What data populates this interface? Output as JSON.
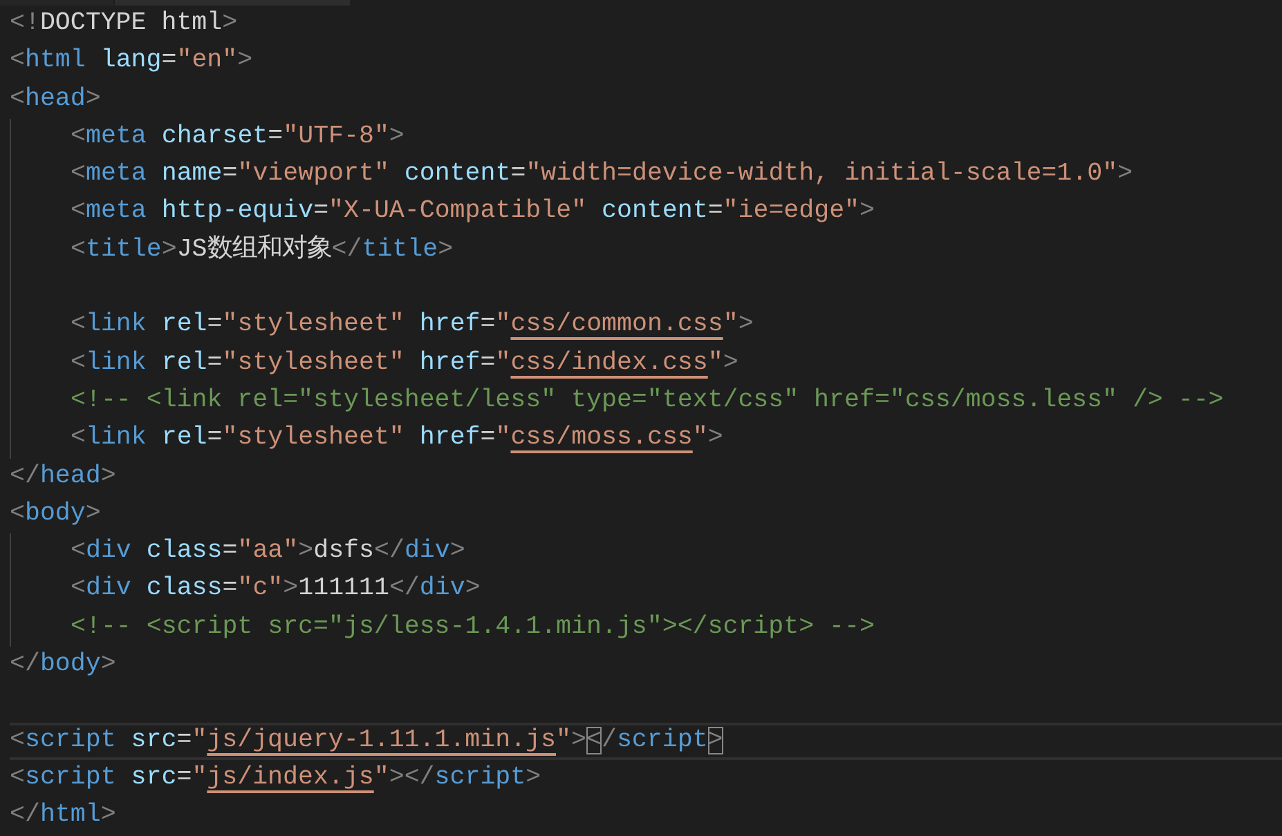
{
  "lines": [
    {
      "kind": "code",
      "current": false,
      "tokens": [
        {
          "kind": "punct",
          "text": "<!"
        },
        {
          "kind": "text",
          "text": "DOCTYPE html"
        },
        {
          "kind": "punct",
          "text": ">"
        }
      ]
    },
    {
      "kind": "code",
      "current": false,
      "tokens": [
        {
          "kind": "punct",
          "text": "<"
        },
        {
          "kind": "tag",
          "text": "html"
        },
        {
          "kind": "attr",
          "text": " lang"
        },
        {
          "kind": "text",
          "text": "="
        },
        {
          "kind": "string",
          "text": "\"en\""
        },
        {
          "kind": "punct",
          "text": ">"
        }
      ]
    },
    {
      "kind": "code",
      "current": false,
      "tokens": [
        {
          "kind": "punct",
          "text": "<"
        },
        {
          "kind": "tag",
          "text": "head"
        },
        {
          "kind": "punct",
          "text": ">"
        }
      ],
      "children": [
        {
          "kind": "code",
          "current": false,
          "tokens": [
            {
              "kind": "punct",
              "text": "<"
            },
            {
              "kind": "tag",
              "text": "meta"
            },
            {
              "kind": "attr",
              "text": " charset"
            },
            {
              "kind": "text",
              "text": "="
            },
            {
              "kind": "string",
              "text": "\"UTF-8\""
            },
            {
              "kind": "punct",
              "text": ">"
            }
          ]
        },
        {
          "kind": "code",
          "current": false,
          "tokens": [
            {
              "kind": "punct",
              "text": "<"
            },
            {
              "kind": "tag",
              "text": "meta"
            },
            {
              "kind": "attr",
              "text": " name"
            },
            {
              "kind": "text",
              "text": "="
            },
            {
              "kind": "string",
              "text": "\"viewport\""
            },
            {
              "kind": "attr",
              "text": " content"
            },
            {
              "kind": "text",
              "text": "="
            },
            {
              "kind": "string",
              "text": "\"width=device-width, initial-scale=1.0\""
            },
            {
              "kind": "punct",
              "text": ">"
            }
          ]
        },
        {
          "kind": "code",
          "current": false,
          "tokens": [
            {
              "kind": "punct",
              "text": "<"
            },
            {
              "kind": "tag",
              "text": "meta"
            },
            {
              "kind": "attr",
              "text": " http-equiv"
            },
            {
              "kind": "text",
              "text": "="
            },
            {
              "kind": "string",
              "text": "\"X-UA-Compatible\""
            },
            {
              "kind": "attr",
              "text": " content"
            },
            {
              "kind": "text",
              "text": "="
            },
            {
              "kind": "string",
              "text": "\"ie=edge\""
            },
            {
              "kind": "punct",
              "text": ">"
            }
          ]
        },
        {
          "kind": "code",
          "current": false,
          "tokens": [
            {
              "kind": "punct",
              "text": "<"
            },
            {
              "kind": "tag",
              "text": "title"
            },
            {
              "kind": "punct",
              "text": ">"
            },
            {
              "kind": "text",
              "text": "JS数组和对象"
            },
            {
              "kind": "punct",
              "text": "</"
            },
            {
              "kind": "tag",
              "text": "title"
            },
            {
              "kind": "punct",
              "text": ">"
            }
          ]
        },
        {
          "kind": "blank",
          "current": false
        },
        {
          "kind": "code",
          "current": false,
          "tokens": [
            {
              "kind": "punct",
              "text": "<"
            },
            {
              "kind": "tag",
              "text": "link"
            },
            {
              "kind": "attr",
              "text": " rel"
            },
            {
              "kind": "text",
              "text": "="
            },
            {
              "kind": "string",
              "text": "\"stylesheet\""
            },
            {
              "kind": "attr",
              "text": " href"
            },
            {
              "kind": "text",
              "text": "="
            },
            {
              "kind": "string",
              "text": "\""
            },
            {
              "kind": "link",
              "text": "css/common.css"
            },
            {
              "kind": "string",
              "text": "\""
            },
            {
              "kind": "punct",
              "text": ">"
            }
          ]
        },
        {
          "kind": "code",
          "current": false,
          "tokens": [
            {
              "kind": "punct",
              "text": "<"
            },
            {
              "kind": "tag",
              "text": "link"
            },
            {
              "kind": "attr",
              "text": " rel"
            },
            {
              "kind": "text",
              "text": "="
            },
            {
              "kind": "string",
              "text": "\"stylesheet\""
            },
            {
              "kind": "attr",
              "text": " href"
            },
            {
              "kind": "text",
              "text": "="
            },
            {
              "kind": "string",
              "text": "\""
            },
            {
              "kind": "link",
              "text": "css/index.css"
            },
            {
              "kind": "string",
              "text": "\""
            },
            {
              "kind": "punct",
              "text": ">"
            }
          ]
        },
        {
          "kind": "code",
          "current": false,
          "tokens": [
            {
              "kind": "comment",
              "text": "<!-- <link rel=\"stylesheet/less\" type=\"text/css\" href=\"css/moss.less\" /> -->"
            }
          ]
        },
        {
          "kind": "code",
          "current": false,
          "tokens": [
            {
              "kind": "punct",
              "text": "<"
            },
            {
              "kind": "tag",
              "text": "link"
            },
            {
              "kind": "attr",
              "text": " rel"
            },
            {
              "kind": "text",
              "text": "="
            },
            {
              "kind": "string",
              "text": "\"stylesheet\""
            },
            {
              "kind": "attr",
              "text": " href"
            },
            {
              "kind": "text",
              "text": "="
            },
            {
              "kind": "string",
              "text": "\""
            },
            {
              "kind": "link",
              "text": "css/moss.css"
            },
            {
              "kind": "string",
              "text": "\""
            },
            {
              "kind": "punct",
              "text": ">"
            }
          ]
        }
      ]
    },
    {
      "kind": "code",
      "current": false,
      "tokens": [
        {
          "kind": "punct",
          "text": "</"
        },
        {
          "kind": "tag",
          "text": "head"
        },
        {
          "kind": "punct",
          "text": ">"
        }
      ]
    },
    {
      "kind": "code",
      "current": false,
      "tokens": [
        {
          "kind": "punct",
          "text": "<"
        },
        {
          "kind": "tag",
          "text": "body"
        },
        {
          "kind": "punct",
          "text": ">"
        }
      ],
      "children": [
        {
          "kind": "code",
          "current": false,
          "tokens": [
            {
              "kind": "punct",
              "text": "<"
            },
            {
              "kind": "tag",
              "text": "div"
            },
            {
              "kind": "attr",
              "text": " class"
            },
            {
              "kind": "text",
              "text": "="
            },
            {
              "kind": "string",
              "text": "\"aa\""
            },
            {
              "kind": "punct",
              "text": ">"
            },
            {
              "kind": "text",
              "text": "dsfs"
            },
            {
              "kind": "punct",
              "text": "</"
            },
            {
              "kind": "tag",
              "text": "div"
            },
            {
              "kind": "punct",
              "text": ">"
            }
          ]
        },
        {
          "kind": "code",
          "current": false,
          "tokens": [
            {
              "kind": "punct",
              "text": "<"
            },
            {
              "kind": "tag",
              "text": "div"
            },
            {
              "kind": "attr",
              "text": " class"
            },
            {
              "kind": "text",
              "text": "="
            },
            {
              "kind": "string",
              "text": "\"c\""
            },
            {
              "kind": "punct",
              "text": ">"
            },
            {
              "kind": "text",
              "text": "111111"
            },
            {
              "kind": "punct",
              "text": "</"
            },
            {
              "kind": "tag",
              "text": "div"
            },
            {
              "kind": "punct",
              "text": ">"
            }
          ]
        },
        {
          "kind": "code",
          "current": false,
          "tokens": [
            {
              "kind": "comment",
              "text": "<!-- <script src=\"js/less-1.4.1.min.js\"></script> -->"
            }
          ]
        }
      ]
    },
    {
      "kind": "code",
      "current": false,
      "tokens": [
        {
          "kind": "punct",
          "text": "</"
        },
        {
          "kind": "tag",
          "text": "body"
        },
        {
          "kind": "punct",
          "text": ">"
        }
      ]
    },
    {
      "kind": "blank",
      "current": false
    },
    {
      "kind": "code",
      "current": true,
      "tokens": [
        {
          "kind": "punct",
          "text": "<"
        },
        {
          "kind": "tag",
          "text": "script"
        },
        {
          "kind": "attr",
          "text": " src"
        },
        {
          "kind": "text",
          "text": "="
        },
        {
          "kind": "string",
          "text": "\""
        },
        {
          "kind": "link",
          "text": "js/jquery-1.11.1.min.js"
        },
        {
          "kind": "string",
          "text": "\""
        },
        {
          "kind": "punct",
          "text": ">"
        },
        {
          "kind": "bracket_match",
          "text": "<"
        },
        {
          "kind": "punct",
          "text": "/"
        },
        {
          "kind": "tag",
          "text": "script"
        },
        {
          "kind": "bracket_match",
          "text": ">"
        }
      ]
    },
    {
      "kind": "code",
      "current": false,
      "tokens": [
        {
          "kind": "punct",
          "text": "<"
        },
        {
          "kind": "tag",
          "text": "script"
        },
        {
          "kind": "attr",
          "text": " src"
        },
        {
          "kind": "text",
          "text": "="
        },
        {
          "kind": "string",
          "text": "\""
        },
        {
          "kind": "link",
          "text": "js/index.js"
        },
        {
          "kind": "string",
          "text": "\""
        },
        {
          "kind": "punct",
          "text": ">"
        },
        {
          "kind": "punct",
          "text": "</"
        },
        {
          "kind": "tag",
          "text": "script"
        },
        {
          "kind": "punct",
          "text": ">"
        }
      ]
    },
    {
      "kind": "code",
      "current": false,
      "tokens": [
        {
          "kind": "punct",
          "text": "</"
        },
        {
          "kind": "tag",
          "text": "html"
        },
        {
          "kind": "punct",
          "text": ">"
        }
      ]
    }
  ]
}
